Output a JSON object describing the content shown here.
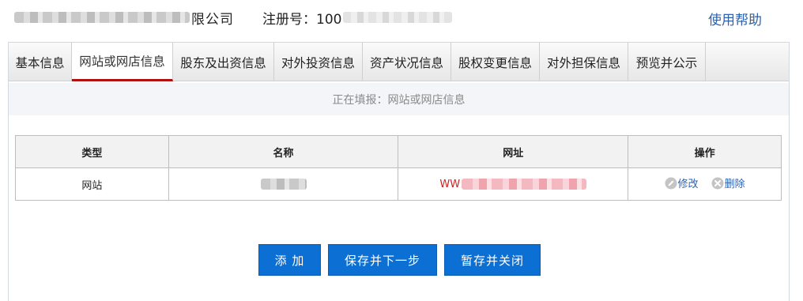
{
  "header": {
    "company_suffix": "限公司",
    "reg_label": "注册号：100",
    "help_link": "使用帮助"
  },
  "tabs": [
    {
      "label": "基本信息"
    },
    {
      "label": "网站或网店信息",
      "active": true
    },
    {
      "label": "股东及出资信息"
    },
    {
      "label": "对外投资信息"
    },
    {
      "label": "资产状况信息"
    },
    {
      "label": "股权变更信息"
    },
    {
      "label": "对外担保信息"
    },
    {
      "label": "预览并公示"
    }
  ],
  "status_text": "正在填报：网站或网店信息",
  "table": {
    "columns": [
      "类型",
      "名称",
      "网址",
      "操作"
    ],
    "rows": [
      {
        "type": "网站",
        "url_prefix": "WW",
        "edit_label": "修改",
        "delete_label": "删除"
      }
    ]
  },
  "buttons": {
    "add": "添 加",
    "save_next": "保存并下一步",
    "save_close": "暂存并关闭"
  },
  "colors": {
    "accent": "#0c6fd4",
    "active_tab_underline": "#b40f10",
    "link": "#2b62b1",
    "url_text": "#d01f1f"
  }
}
